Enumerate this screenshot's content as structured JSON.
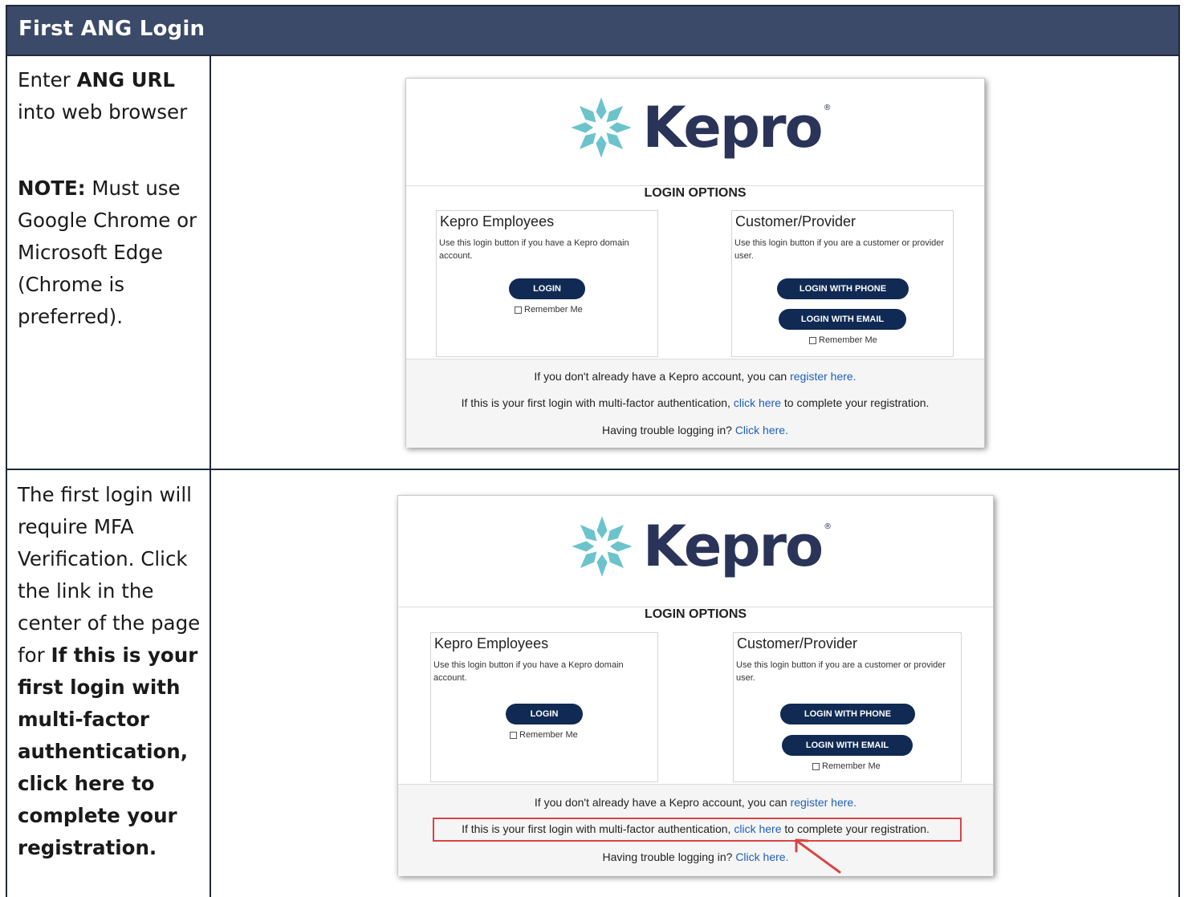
{
  "header": {
    "title": "First ANG Login"
  },
  "rows": [
    {
      "instruction": {
        "p1_pre": "Enter ",
        "p1_bold": "ANG URL",
        "p1_post": " into web browser",
        "p2_bold": "NOTE:",
        "p2_text": " Must use Google Chrome or Microsoft Edge (Chrome is preferred)."
      }
    },
    {
      "instruction": {
        "text": "The first login will require MFA Verification.  Click the link in the center of the page for ",
        "bold": "If this is your first login with multi-factor authentication, click here to complete your registration."
      }
    }
  ],
  "login_page": {
    "logo_text": "Kepro",
    "logo_reg": "®",
    "options_title": "LOGIN OPTIONS",
    "employees": {
      "title": "Kepro Employees",
      "desc": "Use this login button if you have a Kepro domain account.",
      "login_button": "LOGIN",
      "remember": "Remember Me"
    },
    "customer": {
      "title": "Customer/Provider",
      "desc": "Use this login button if you are a customer or provider user.",
      "phone_button": "LOGIN WITH PHONE",
      "email_button": "LOGIN WITH EMAIL",
      "remember": "Remember Me"
    },
    "footer": {
      "register_pre": "If you don't already have a Kepro account, you can ",
      "register_link": "register here.",
      "mfa_pre": "If this is your first login with multi-factor authentication, ",
      "mfa_link": "click here",
      "mfa_post": " to complete your registration.",
      "trouble_pre": "Having trouble logging in? ",
      "trouble_link": "Click here."
    }
  },
  "colors": {
    "header_bg": "#3b4a68",
    "button_navy": "#102a54",
    "logo_teal": "#6cc3cc",
    "logo_navy": "#2a3459",
    "link_blue": "#1f5fb8",
    "highlight_red": "#d84545"
  }
}
